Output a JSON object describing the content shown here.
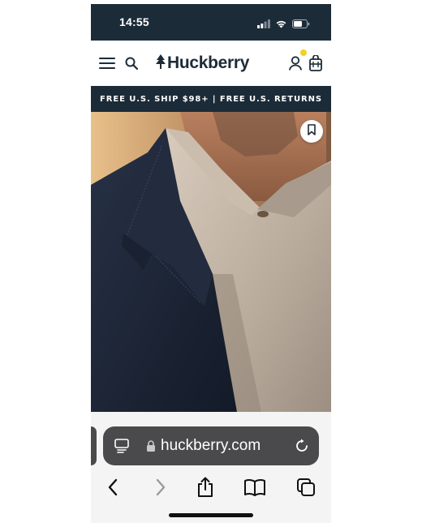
{
  "status_bar": {
    "time": "14:55",
    "icons": [
      "cellular-signal-icon",
      "wifi-icon",
      "battery-icon"
    ],
    "background": "#1c2b38"
  },
  "header": {
    "brand": "Huckberry",
    "icons": [
      "menu-icon",
      "search-icon",
      "account-icon",
      "cart-icon"
    ],
    "cart_badge_color": "#f2d21b"
  },
  "promo": {
    "text": "FREE U.S. SHIP $98+ | FREE U.S. RETURNS",
    "background": "#1c2b38"
  },
  "hero": {
    "icon": "bookmark-icon"
  },
  "browser": {
    "url": "huckberry.com",
    "url_icons": [
      "page-menu-icon",
      "lock-icon",
      "reload-icon"
    ],
    "nav_icons": [
      "back-icon",
      "forward-icon",
      "share-icon",
      "bookmarks-icon",
      "tabs-icon"
    ]
  }
}
